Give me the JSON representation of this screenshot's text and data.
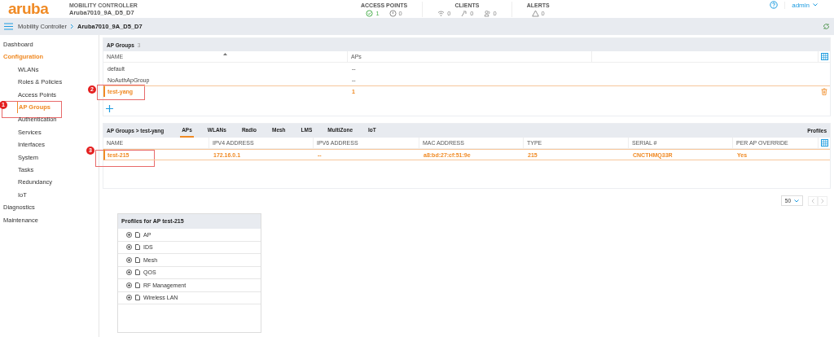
{
  "header": {
    "logo": "aruba",
    "controller_label": "MOBILITY CONTROLLER",
    "controller_name": "Aruba7010_9A_D5_D7",
    "stats": [
      {
        "label": "ACCESS POINTS",
        "items": [
          {
            "kind": "up",
            "value": "1",
            "highlighted": true
          },
          {
            "kind": "down",
            "value": "0",
            "highlighted": false
          }
        ]
      },
      {
        "label": "CLIENTS",
        "items": [
          {
            "kind": "wireless",
            "value": "0",
            "highlighted": false
          },
          {
            "kind": "remote",
            "value": "0",
            "highlighted": false
          },
          {
            "kind": "users",
            "value": "0",
            "highlighted": false
          }
        ]
      },
      {
        "label": "ALERTS",
        "items": [
          {
            "kind": "warning",
            "value": "0",
            "highlighted": false
          }
        ]
      }
    ],
    "user": "admin"
  },
  "breadcrumb": [
    "Mobility Controller",
    "Aruba7010_9A_D5_D7"
  ],
  "sidebar": {
    "items": [
      {
        "label": "Dashboard",
        "kind": "section",
        "selected": false
      },
      {
        "label": "Configuration",
        "kind": "section",
        "selected": true
      },
      {
        "label": "WLANs",
        "kind": "sub",
        "selected": false
      },
      {
        "label": "Roles & Policies",
        "kind": "sub",
        "selected": false
      },
      {
        "label": "Access Points",
        "kind": "sub",
        "selected": false
      },
      {
        "label": "AP Groups",
        "kind": "sub",
        "selected": true,
        "callout": "1"
      },
      {
        "label": "Authentication",
        "kind": "sub",
        "selected": false
      },
      {
        "label": "Services",
        "kind": "sub",
        "selected": false
      },
      {
        "label": "Interfaces",
        "kind": "sub",
        "selected": false
      },
      {
        "label": "System",
        "kind": "sub",
        "selected": false
      },
      {
        "label": "Tasks",
        "kind": "sub",
        "selected": false
      },
      {
        "label": "Redundancy",
        "kind": "sub",
        "selected": false
      },
      {
        "label": "IoT",
        "kind": "sub",
        "selected": false
      },
      {
        "label": "Diagnostics",
        "kind": "section",
        "selected": false
      },
      {
        "label": "Maintenance",
        "kind": "section",
        "selected": false
      }
    ]
  },
  "ap_groups": {
    "title": "AP Groups",
    "count": "3",
    "columns": [
      "NAME",
      "APs"
    ],
    "rows": [
      {
        "name": "default",
        "aps": "--",
        "selected": false
      },
      {
        "name": "NoAuthApGroup",
        "aps": "--",
        "selected": false
      },
      {
        "name": "test-yang",
        "aps": "1",
        "selected": true,
        "callout": "2"
      }
    ]
  },
  "ap_panel": {
    "title": "AP Groups > test-yang",
    "profiles_link": "Profiles",
    "tabs": [
      {
        "label": "APs",
        "selected": true
      },
      {
        "label": "WLANs",
        "selected": false
      },
      {
        "label": "Radio",
        "selected": false
      },
      {
        "label": "Mesh",
        "selected": false
      },
      {
        "label": "LMS",
        "selected": false
      },
      {
        "label": "MultiZone",
        "selected": false
      },
      {
        "label": "IoT",
        "selected": false
      }
    ],
    "columns": [
      "NAME",
      "IPV4 ADDRESS",
      "IPV6 ADDRESS",
      "MAC ADDRESS",
      "TYPE",
      "SERIAL #",
      "PER AP OVERRIDE"
    ],
    "rows": [
      {
        "cells": [
          "test-215",
          "172.16.0.1",
          "--",
          "a8:bd:27:cf:51:9e",
          "215",
          "CNCTHMQ33R",
          "Yes"
        ],
        "selected": true,
        "callout": "3"
      }
    ]
  },
  "pagination": {
    "page_size": "50"
  },
  "profiles": {
    "title": "Profiles for AP test-215",
    "items": [
      "AP",
      "IDS",
      "Mesh",
      "QOS",
      "RF Management",
      "Wireless LAN"
    ]
  }
}
